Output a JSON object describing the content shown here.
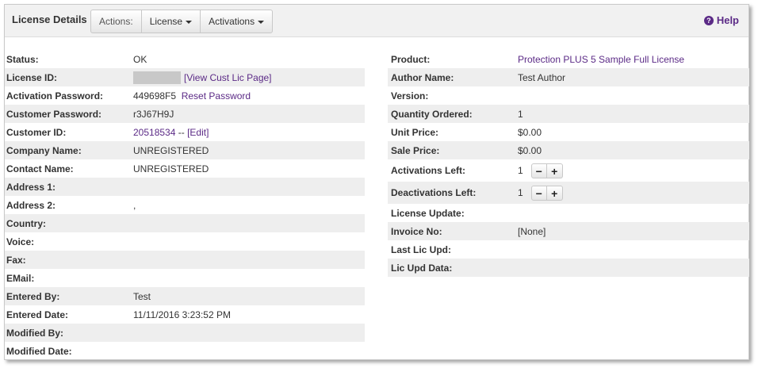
{
  "toolbar": {
    "title": "License Details",
    "actions_label": "Actions:",
    "license_label": "License",
    "activations_label": "Activations",
    "help_label": "Help"
  },
  "left": {
    "status": {
      "label": "Status:",
      "value": "OK"
    },
    "license_id": {
      "label": "License ID:",
      "link": "[View Cust Lic Page]"
    },
    "activation_password": {
      "label": "Activation Password:",
      "value": "449698F5",
      "link": "Reset Password"
    },
    "customer_password": {
      "label": "Customer Password:",
      "value": "r3J67H9J"
    },
    "customer_id": {
      "label": "Customer ID:",
      "value": "20518534",
      "sep": " -- ",
      "link": "[Edit]"
    },
    "company_name": {
      "label": "Company Name:",
      "value": "UNREGISTERED"
    },
    "contact_name": {
      "label": "Contact Name:",
      "value": "UNREGISTERED"
    },
    "address1": {
      "label": "Address 1:",
      "value": ""
    },
    "address2": {
      "label": "Address 2:",
      "value": ","
    },
    "country": {
      "label": "Country:",
      "value": ""
    },
    "voice": {
      "label": "Voice:",
      "value": ""
    },
    "fax": {
      "label": "Fax:",
      "value": ""
    },
    "email": {
      "label": "EMail:",
      "value": ""
    },
    "entered_by": {
      "label": "Entered By:",
      "value": "Test"
    },
    "entered_date": {
      "label": "Entered Date:",
      "value": "11/11/2016 3:23:52 PM"
    },
    "modified_by": {
      "label": "Modified By:",
      "value": ""
    },
    "modified_date": {
      "label": "Modified Date:",
      "value": ""
    }
  },
  "right": {
    "product": {
      "label": "Product:",
      "value": "Protection PLUS 5 Sample Full License"
    },
    "author_name": {
      "label": "Author Name:",
      "value": "Test Author"
    },
    "version": {
      "label": "Version:",
      "value": ""
    },
    "quantity_ordered": {
      "label": "Quantity Ordered:",
      "value": "1"
    },
    "unit_price": {
      "label": "Unit Price:",
      "value": "$0.00"
    },
    "sale_price": {
      "label": "Sale Price:",
      "value": "$0.00"
    },
    "activations_left": {
      "label": "Activations Left:",
      "value": "1"
    },
    "deactivations_left": {
      "label": "Deactivations Left:",
      "value": "1"
    },
    "license_update": {
      "label": "License Update:",
      "value": ""
    },
    "invoice_no": {
      "label": "Invoice No:",
      "value": "[None]"
    },
    "last_lic_upd": {
      "label": "Last Lic Upd:",
      "value": ""
    },
    "lic_upd_data": {
      "label": "Lic Upd Data:",
      "value": ""
    }
  },
  "stepper": {
    "minus": "−",
    "plus": "+"
  },
  "colors": {
    "accent": "#5b2a86",
    "row_alt": "#eeeeee",
    "toolbar_bg": "#f1f1f1"
  },
  "icons": {
    "help": "question-circle-icon",
    "caret": "caret-down-icon"
  }
}
